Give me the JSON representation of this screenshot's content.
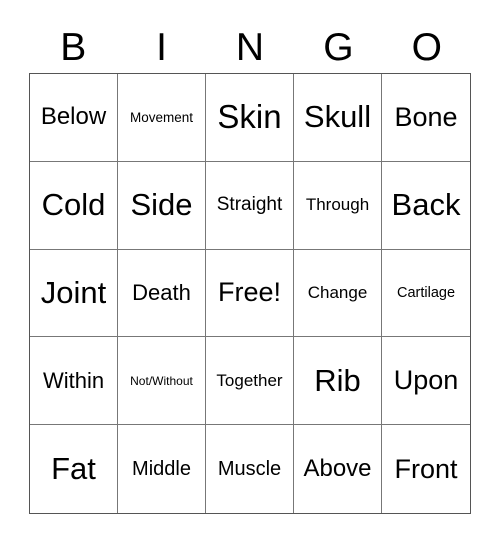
{
  "card": {
    "header": [
      "B",
      "I",
      "N",
      "G",
      "O"
    ],
    "rows": [
      [
        "Below",
        "Movement",
        "Skin",
        "Skull",
        "Bone"
      ],
      [
        "Cold",
        "Side",
        "Straight",
        "Through",
        "Back"
      ],
      [
        "Joint",
        "Death",
        "Free!",
        "Change",
        "Cartilage"
      ],
      [
        "Within",
        "Not/Without",
        "Together",
        "Rib",
        "Upon"
      ],
      [
        "Fat",
        "Middle",
        "Muscle",
        "Above",
        "Front"
      ]
    ]
  }
}
